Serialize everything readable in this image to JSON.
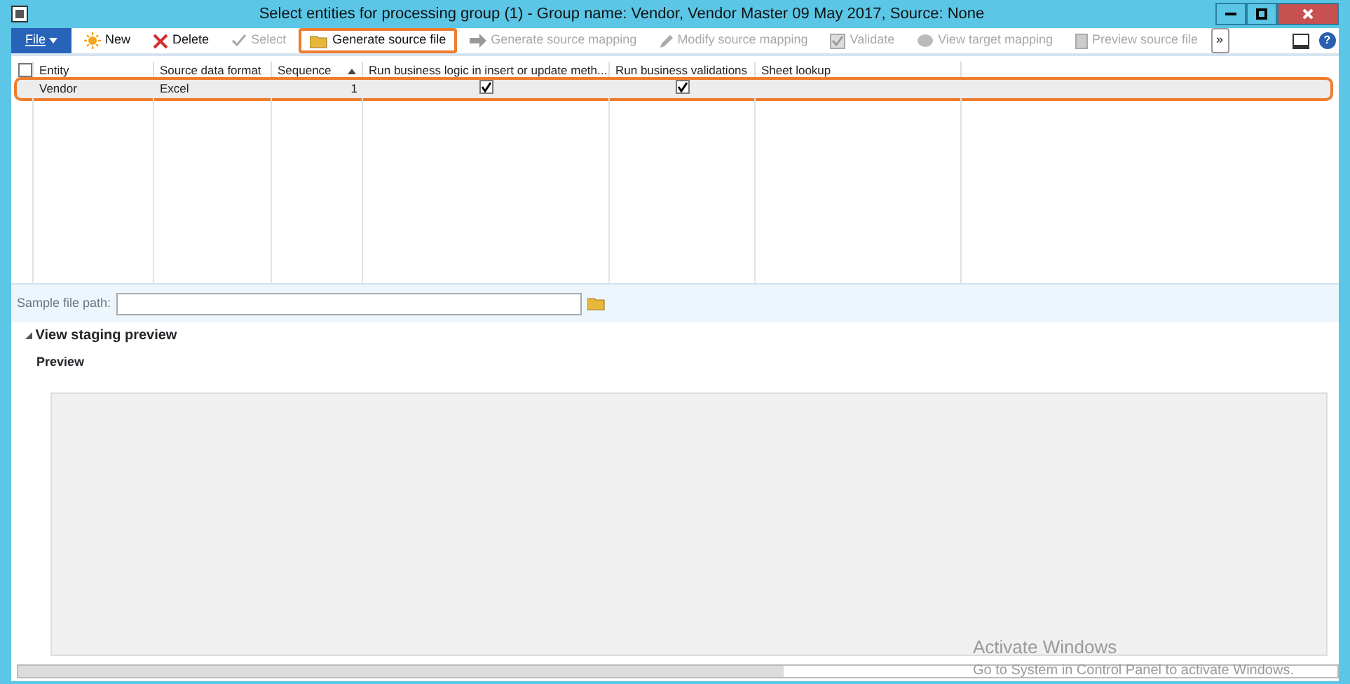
{
  "window": {
    "title": "Select entities for processing group (1) - Group name: Vendor, Vendor Master 09 May 2017, Source: None"
  },
  "toolbar": {
    "file_menu": "File",
    "buttons": [
      {
        "label": "New",
        "disabled": false,
        "highlighted": false
      },
      {
        "label": "Delete",
        "disabled": false,
        "highlighted": false
      },
      {
        "label": "Select",
        "disabled": true,
        "highlighted": false
      },
      {
        "label": "Generate source file",
        "disabled": false,
        "highlighted": true
      },
      {
        "label": "Generate source mapping",
        "disabled": true,
        "highlighted": false
      },
      {
        "label": "Modify source mapping",
        "disabled": true,
        "highlighted": false
      },
      {
        "label": "Validate",
        "disabled": true,
        "highlighted": false
      },
      {
        "label": "View target mapping",
        "disabled": true,
        "highlighted": false
      },
      {
        "label": "Preview source file",
        "disabled": true,
        "highlighted": false
      }
    ],
    "overflow": "»",
    "help": "?"
  },
  "table": {
    "all_selected": false,
    "columns": [
      "Entity",
      "Source data format",
      "Sequence",
      "Run business logic in insert or update meth...",
      "Run business validations",
      "Sheet lookup"
    ],
    "rows": [
      {
        "entity": "Vendor",
        "format": "Excel",
        "sequence": "1",
        "business_logic": true,
        "validations": true,
        "highlighted": true
      }
    ]
  },
  "sample_file_path": {
    "label": "Sample file path:"
  },
  "staging": {
    "title": "View staging preview",
    "expanded": true,
    "subtitle": "Preview"
  },
  "os_notice": {
    "title": "Activate Windows",
    "text": "Go to System in Control Panel to activate Windows."
  }
}
